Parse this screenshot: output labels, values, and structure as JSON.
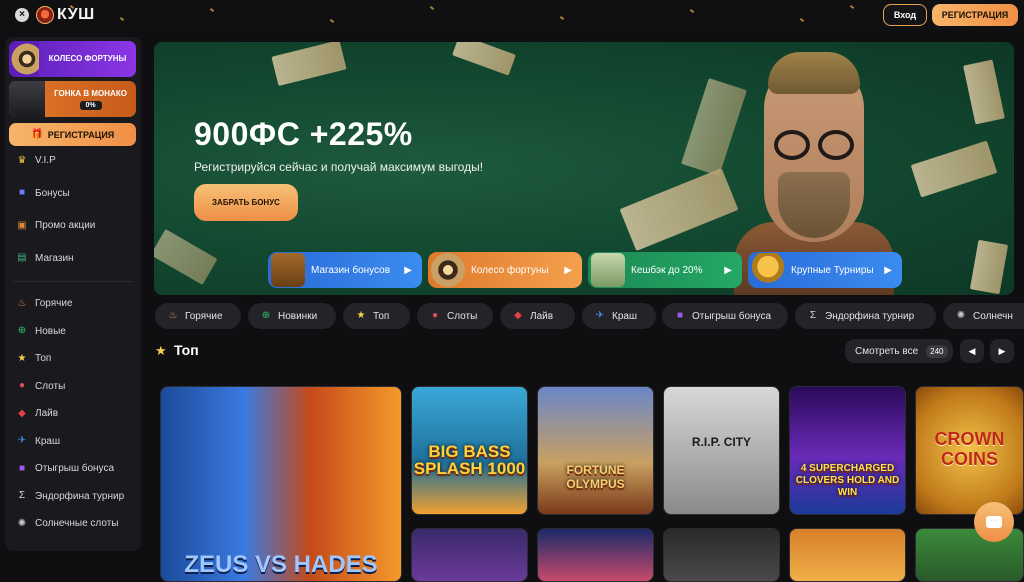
{
  "header": {
    "close_icon": "close-icon",
    "logo_text": "КУШ",
    "login_label": "Вход",
    "register_label": "РЕГИСТРАЦИЯ"
  },
  "sidebar": {
    "promo_wheel_label": "КОЛЕСО ФОРТУНЫ",
    "promo_race_label": "ГОНКА В МОНАКО",
    "promo_race_progress": "0%",
    "register_label": "РЕГИСТРАЦИЯ",
    "menu": [
      {
        "label": "V.I.P",
        "icon": "crown-icon"
      },
      {
        "label": "Бонусы",
        "icon": "gift-icon"
      },
      {
        "label": "Промо акции",
        "icon": "promo-icon"
      },
      {
        "label": "Магазин",
        "icon": "shop-icon"
      }
    ],
    "categories": [
      {
        "label": "Горячие",
        "icon": "flame-icon"
      },
      {
        "label": "Новые",
        "icon": "plus-icon"
      },
      {
        "label": "Топ",
        "icon": "star-icon"
      },
      {
        "label": "Слоты",
        "icon": "cherry-icon"
      },
      {
        "label": "Лайв",
        "icon": "dice-icon"
      },
      {
        "label": "Краш",
        "icon": "plane-icon"
      },
      {
        "label": "Отыгрыш бонуса",
        "icon": "gift-icon"
      },
      {
        "label": "Эндорфина турнир",
        "icon": "sigma-icon"
      },
      {
        "label": "Солнечные слоты",
        "icon": "sun-icon"
      }
    ]
  },
  "banner": {
    "headline": "900ФС +225%",
    "subline": "Регистрируйся сейчас и получай максимум выгоды!",
    "cta_label": "ЗАБРАТЬ БОНУС",
    "pills": [
      {
        "label": "Магазин бонусов"
      },
      {
        "label": "Колесо фортуны"
      },
      {
        "label": "Кешбэк до 20%"
      },
      {
        "label": "Крупные Турниры"
      }
    ]
  },
  "filters": [
    {
      "label": "Горячие",
      "icon": "flame-icon"
    },
    {
      "label": "Новинки",
      "icon": "plus-icon"
    },
    {
      "label": "Топ",
      "icon": "star-icon"
    },
    {
      "label": "Слоты",
      "icon": "cherry-icon"
    },
    {
      "label": "Лайв",
      "icon": "dice-icon"
    },
    {
      "label": "Краш",
      "icon": "plane-icon"
    },
    {
      "label": "Отыгрыш бонуса",
      "icon": "gift-icon"
    },
    {
      "label": "Эндорфина турнир",
      "icon": "sigma-icon"
    },
    {
      "label": "Солнечн",
      "icon": "sun-icon"
    }
  ],
  "section": {
    "title": "Топ",
    "see_all_label": "Смотреть все",
    "see_all_count": "240"
  },
  "games": [
    {
      "title": "ZEUS VS HADES"
    },
    {
      "title": "BIG BASS SPLASH 1000"
    },
    {
      "title": "FORTUNE OLYMPUS"
    },
    {
      "title": "R.I.P. CITY"
    },
    {
      "title": "4 SUPERCHARGED CLOVERS HOLD AND WIN"
    },
    {
      "title": "CROWN COINS"
    }
  ],
  "colors": {
    "accent": "#f08f45",
    "background": "#0f0f12",
    "banner_green": "#134a31",
    "pill_blue": "#3b8cf0"
  }
}
